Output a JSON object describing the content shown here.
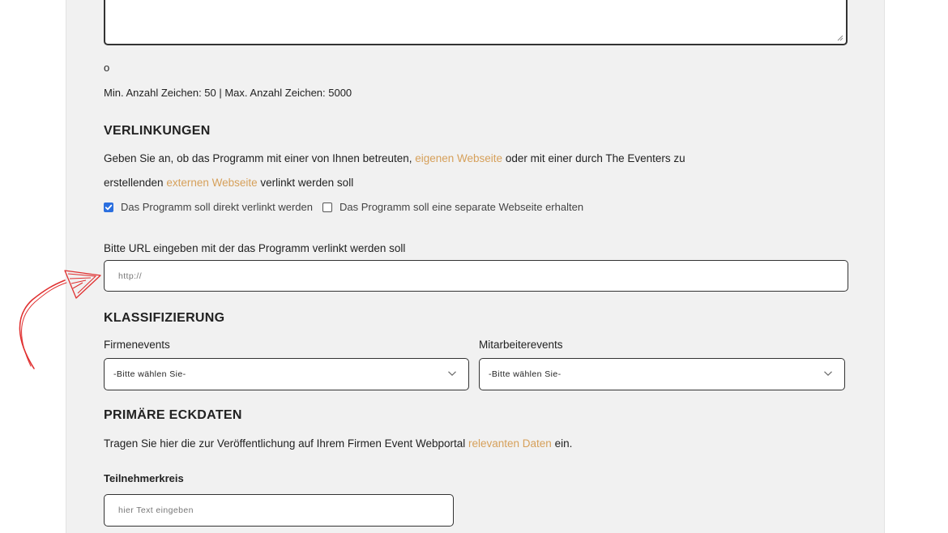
{
  "description": {
    "char_count": "o",
    "limits": "Min. Anzahl Zeichen: 50 | Max. Anzahl Zeichen: 5000"
  },
  "links_section": {
    "heading": "VERLINKUNGEN",
    "intro_part1": "Geben Sie an, ob das Programm mit einer von Ihnen betreuten, ",
    "intro_link1": "eigenen Webseite",
    "intro_part2": " oder mit einer durch The Eventers zu",
    "intro_part3": "erstellenden ",
    "intro_link2": "externen Webseite",
    "intro_part4": " verlinkt werden soll",
    "option_direct": "Das Programm soll direkt verlinkt werden",
    "option_separate": "Das Programm soll eine separate Webseite erhalten",
    "url_label": "Bitte URL eingeben mit der das Programm verlinkt werden soll",
    "url_placeholder": "http://"
  },
  "classification": {
    "heading": "KLASSIFIZIERUNG",
    "company_label": "Firmenevents",
    "company_value": "-Bitte wählen Sie-",
    "employee_label": "Mitarbeiterevents",
    "employee_value": "-Bitte wählen Sie-"
  },
  "primary": {
    "heading": "PRIMÄRE ECKDATEN",
    "intro_part1": "Tragen Sie hier die zur Veröffentlichung auf Ihrem Firmen Event Webportal ",
    "intro_link": "relevanten Daten",
    "intro_part2": " ein.",
    "participants_label": "Teilnehmerkreis",
    "participants_placeholder": "hier Text eingeben"
  },
  "colors": {
    "accent_link": "#d6a05a",
    "checkbox_checked": "#2b6fdf",
    "annotation_arrow": "#e03030"
  }
}
